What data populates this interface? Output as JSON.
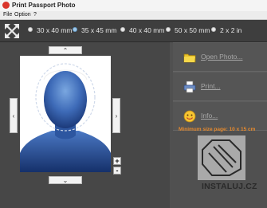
{
  "window": {
    "title": "Print Passport Photo"
  },
  "menu": {
    "items": [
      "File",
      "Option",
      "?"
    ]
  },
  "toolbar": {
    "sizes": [
      "30 x 40 mm",
      "35 x 45 mm",
      "40 x 40 mm",
      "50 x 50 mm",
      "2 x 2 in"
    ],
    "selected": "35 x 45 mm"
  },
  "photo_controls": {
    "zoom_in": "+",
    "zoom_out": "-"
  },
  "side_panel": {
    "open_label": "Open Photo...",
    "print_label": "Print...",
    "info_label": "Info...",
    "min_size_text": "Minimum size page: 10 x 15 cm"
  },
  "watermark": {
    "text": "INSTALUJ.CZ"
  },
  "colors": {
    "accent_orange": "#e68a2e",
    "background": "#3c3c3c",
    "panel": "#505050"
  }
}
